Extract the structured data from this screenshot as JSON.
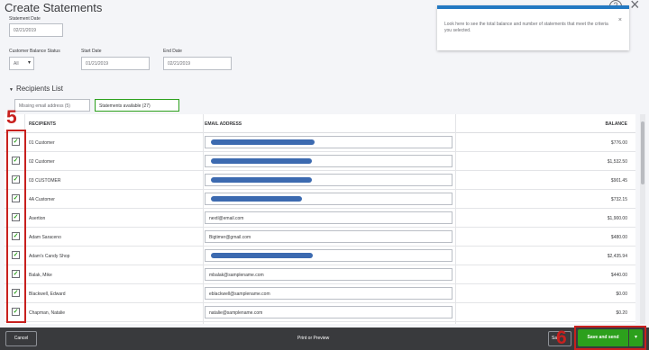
{
  "header": {
    "title": "Create Statements",
    "help_glyph": "?",
    "close_glyph": "×"
  },
  "filters": {
    "statement_date_label": "Statement Date",
    "statement_date_value": "02/21/2019",
    "balance_status_label": "Customer Balance Status",
    "balance_status_value": "All",
    "start_date_label": "Start Date",
    "start_date_value": "01/21/2019",
    "end_date_label": "End Date",
    "end_date_value": "02/21/2019"
  },
  "tooltip": {
    "text": "Look here to see the total balance and number of statements that meet the criteria you selected.",
    "close_glyph": "×"
  },
  "recipients": {
    "section_title": "Recipients List",
    "tabs": [
      {
        "label": "Missing email address (5)"
      },
      {
        "label": "Statements available (27)"
      }
    ]
  },
  "table": {
    "headers": {
      "recipients": "RECIPIENTS",
      "email": "EMAIL ADDRESS",
      "balance": "BALANCE"
    },
    "rows": [
      {
        "name": "01 Customer",
        "email": "",
        "redacted": true,
        "balance": "$776.00",
        "checked": true
      },
      {
        "name": "02 Customer",
        "email": "",
        "redacted": true,
        "balance": "$1,532.50",
        "checked": true
      },
      {
        "name": "03 CUSTOMER",
        "email": "",
        "redacted": true,
        "balance": "$901.45",
        "checked": true
      },
      {
        "name": "4A Customer",
        "email": "",
        "redacted": true,
        "balance": "$732.15",
        "checked": true
      },
      {
        "name": "Asertion",
        "email": "nextl@email.com",
        "redacted": false,
        "balance": "$1,900.00",
        "checked": true
      },
      {
        "name": "Adam Saraceno",
        "email": "Bigtimer@gmail.com",
        "redacted": false,
        "balance": "$480.00",
        "checked": true
      },
      {
        "name": "Adam's Candy Shop",
        "email": "",
        "redacted": true,
        "balance": "$2,435.94",
        "checked": true
      },
      {
        "name": "Balak, Mike",
        "email": "mbalak@samplename.com",
        "redacted": false,
        "balance": "$440.00",
        "checked": true
      },
      {
        "name": "Blackwell, Edward",
        "email": "eblackwell@samplename.com",
        "redacted": false,
        "balance": "$0.00",
        "checked": true
      },
      {
        "name": "Chapman, Natalie",
        "email": "natalie@samplename.com",
        "redacted": false,
        "balance": "$0.20",
        "checked": true
      }
    ]
  },
  "annotations": {
    "step_5": "5",
    "step_6": "6",
    "highlight_color": "#c8201e"
  },
  "footer": {
    "cancel_label": "Cancel",
    "print_label": "Print or Preview",
    "save_partial_label": "Sa",
    "save_send_label": "Save and send",
    "dropdown_glyph": "▾"
  },
  "colors": {
    "accent_green": "#2ca01c",
    "footer_bg": "#393a3d",
    "tooltip_border": "#2379c2",
    "redaction": "#3c6ab0"
  }
}
